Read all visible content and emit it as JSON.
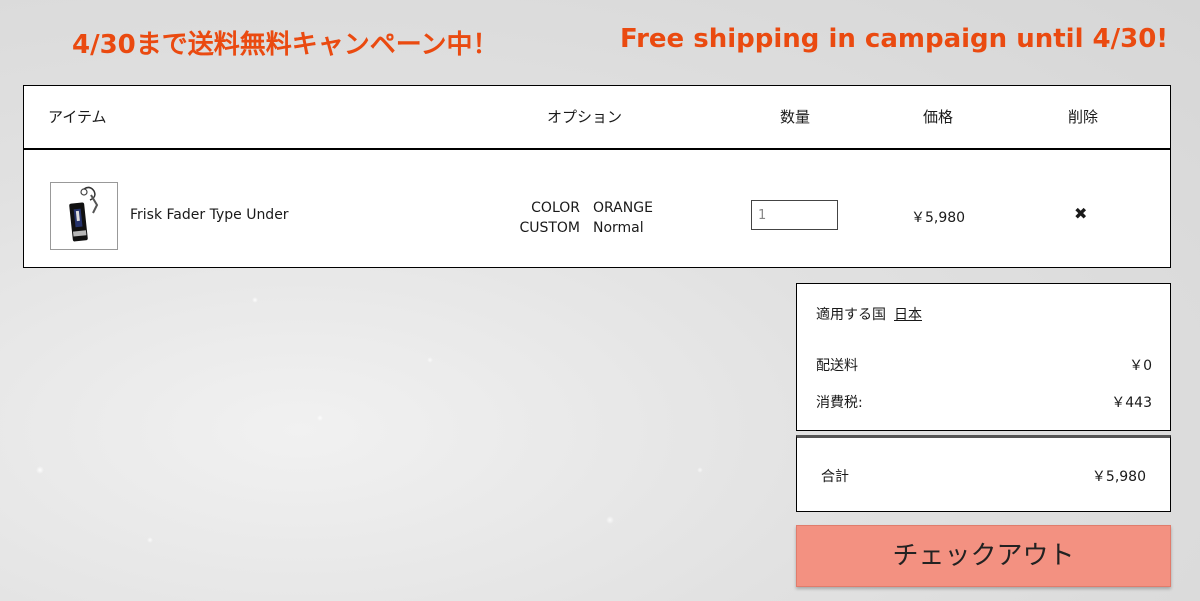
{
  "banner": {
    "jp": "4/30まで送料無料キャンペーン中！",
    "en": "Free shipping in campaign until 4/30!",
    "color": "#ea4a10"
  },
  "cart": {
    "headers": {
      "item": "アイテム",
      "option": "オプション",
      "quantity": "数量",
      "price": "価格",
      "remove": "削除"
    },
    "items": [
      {
        "thumbnail_icon": "fader-product-image",
        "name": "Frisk Fader Type Under",
        "options": [
          {
            "key": "COLOR",
            "value": "ORANGE"
          },
          {
            "key": "CUSTOM",
            "value": "Normal"
          }
        ],
        "quantity": "1",
        "price": "￥5,980",
        "remove_icon": "×"
      }
    ]
  },
  "summary": {
    "country_label": "適用する国",
    "country_value": "日本",
    "shipping_label": "配送料",
    "shipping_value": "￥0",
    "tax_label": "消費税:",
    "tax_value": "￥443",
    "total_label": "合計",
    "total_value": "￥5,980"
  },
  "checkout": {
    "label": "チェックアウト",
    "color": "#f39181"
  }
}
